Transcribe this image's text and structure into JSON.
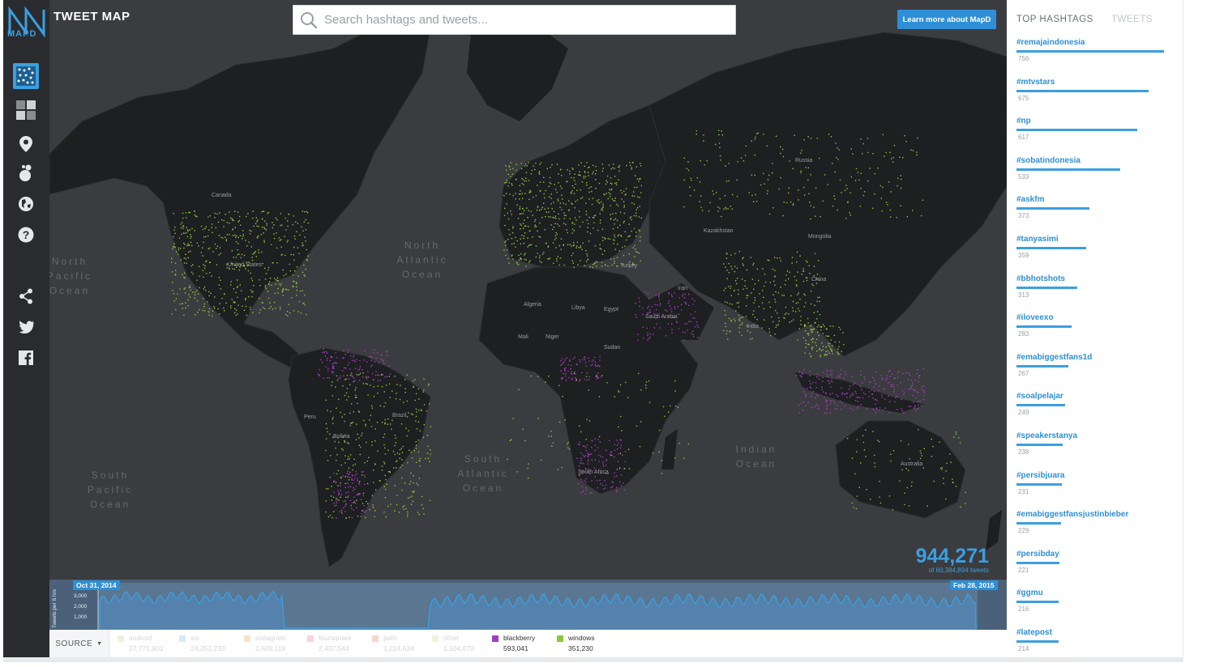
{
  "app": {
    "brand": "MAPD",
    "title": "TWEET MAP"
  },
  "search": {
    "placeholder": "Search hashtags and tweets..."
  },
  "header": {
    "learn_more": "Learn more about MapD"
  },
  "sidebar": {
    "items": [
      {
        "icon": "point-map-icon",
        "active": true
      },
      {
        "icon": "heatmap-icon",
        "active": false
      },
      {
        "icon": "location-pin-icon",
        "active": false
      },
      {
        "icon": "bubble-icon",
        "active": false
      },
      {
        "icon": "globe-icon",
        "active": false
      },
      {
        "icon": "help-icon",
        "active": false
      },
      {
        "icon": "share-icon",
        "active": false
      },
      {
        "icon": "twitter-icon",
        "active": false
      },
      {
        "icon": "facebook-icon",
        "active": false
      }
    ]
  },
  "map": {
    "oceans": {
      "north_pacific": "North\nPacific\nOcean",
      "north_atlantic": "North\nAtlantic\nOcean",
      "south_pacific": "South\nPacific\nOcean",
      "south_atlantic": "South\nAtlantic\nOcean",
      "indian": "Indian\nOcean"
    },
    "countries": {
      "canada": "Canada",
      "us": "United States",
      "brazil": "Brazil",
      "bolivia": "Bolivia",
      "peru": "Peru",
      "algeria": "Algeria",
      "libya": "Libya",
      "egypt": "Egypt",
      "mali": "Mali",
      "niger": "Niger",
      "sudan": "Sudan",
      "south_africa": "South Africa",
      "russia": "Russia",
      "kazakhstan": "Kazakhstan",
      "mongolia": "Mongolia",
      "china": "China",
      "iran": "Iran",
      "saudi": "Saudi Arabia",
      "turkey": "Turkey",
      "australia": "Australia",
      "india": "India"
    },
    "colors": {
      "land": "#1e1f21",
      "ocean": "#3b3c3f",
      "windows": "#8ec63f",
      "blackberry": "#a33fbf"
    }
  },
  "counter": {
    "value": "944,271",
    "subtitle": "of 60,384,894 tweets"
  },
  "timeline": {
    "start_date": "Oct 31, 2014",
    "end_date": "Feb 28, 2015",
    "y_axis_label": "Tweets per 6 hrs",
    "ticks": [
      "3,000",
      "2,000",
      "1,000"
    ]
  },
  "source_legend": {
    "button": "SOURCE",
    "items": [
      {
        "name": "android",
        "count": "27,771,901",
        "color": "#f0f2d8",
        "enabled": false
      },
      {
        "name": "ios",
        "count": "24,253,233",
        "color": "#d6e9f8",
        "enabled": false
      },
      {
        "name": "instagram",
        "count": "2,609,119",
        "color": "#f8e3c9",
        "enabled": false
      },
      {
        "name": "foursquare",
        "count": "2,437,544",
        "color": "#f8d3de",
        "enabled": false
      },
      {
        "name": "path",
        "count": "1,214,634",
        "color": "#f7d5cf",
        "enabled": false
      },
      {
        "name": "other",
        "count": "1,104,678",
        "color": "#f5f1d9",
        "enabled": false
      },
      {
        "name": "blackberry",
        "count": "593,041",
        "color": "#a33fbf",
        "enabled": true
      },
      {
        "name": "windows",
        "count": "351,230",
        "color": "#8ec63f",
        "enabled": true
      }
    ]
  },
  "panel": {
    "tab_hashtags": "TOP HASHTAGS",
    "tab_tweets": "TWEETS",
    "hashtags": [
      {
        "tag": "#remajaindonesia",
        "count": "756",
        "value": 756
      },
      {
        "tag": "#mtvstars",
        "count": "675",
        "value": 675
      },
      {
        "tag": "#np",
        "count": "617",
        "value": 617
      },
      {
        "tag": "#sobatindonesia",
        "count": "533",
        "value": 533
      },
      {
        "tag": "#askfm",
        "count": "373",
        "value": 373
      },
      {
        "tag": "#tanyasimi",
        "count": "359",
        "value": 359
      },
      {
        "tag": "#bbhotshots",
        "count": "313",
        "value": 313
      },
      {
        "tag": "#iloveexo",
        "count": "283",
        "value": 283
      },
      {
        "tag": "#emabiggestfans1d",
        "count": "267",
        "value": 267
      },
      {
        "tag": "#soalpelajar",
        "count": "249",
        "value": 249
      },
      {
        "tag": "#speakerstanya",
        "count": "238",
        "value": 238
      },
      {
        "tag": "#persibjuara",
        "count": "231",
        "value": 231
      },
      {
        "tag": "#emabiggestfansjustinbieber",
        "count": "229",
        "value": 229
      },
      {
        "tag": "#persibday",
        "count": "221",
        "value": 221
      },
      {
        "tag": "#ggmu",
        "count": "216",
        "value": 216
      },
      {
        "tag": "#latepost",
        "count": "214",
        "value": 214
      }
    ]
  }
}
